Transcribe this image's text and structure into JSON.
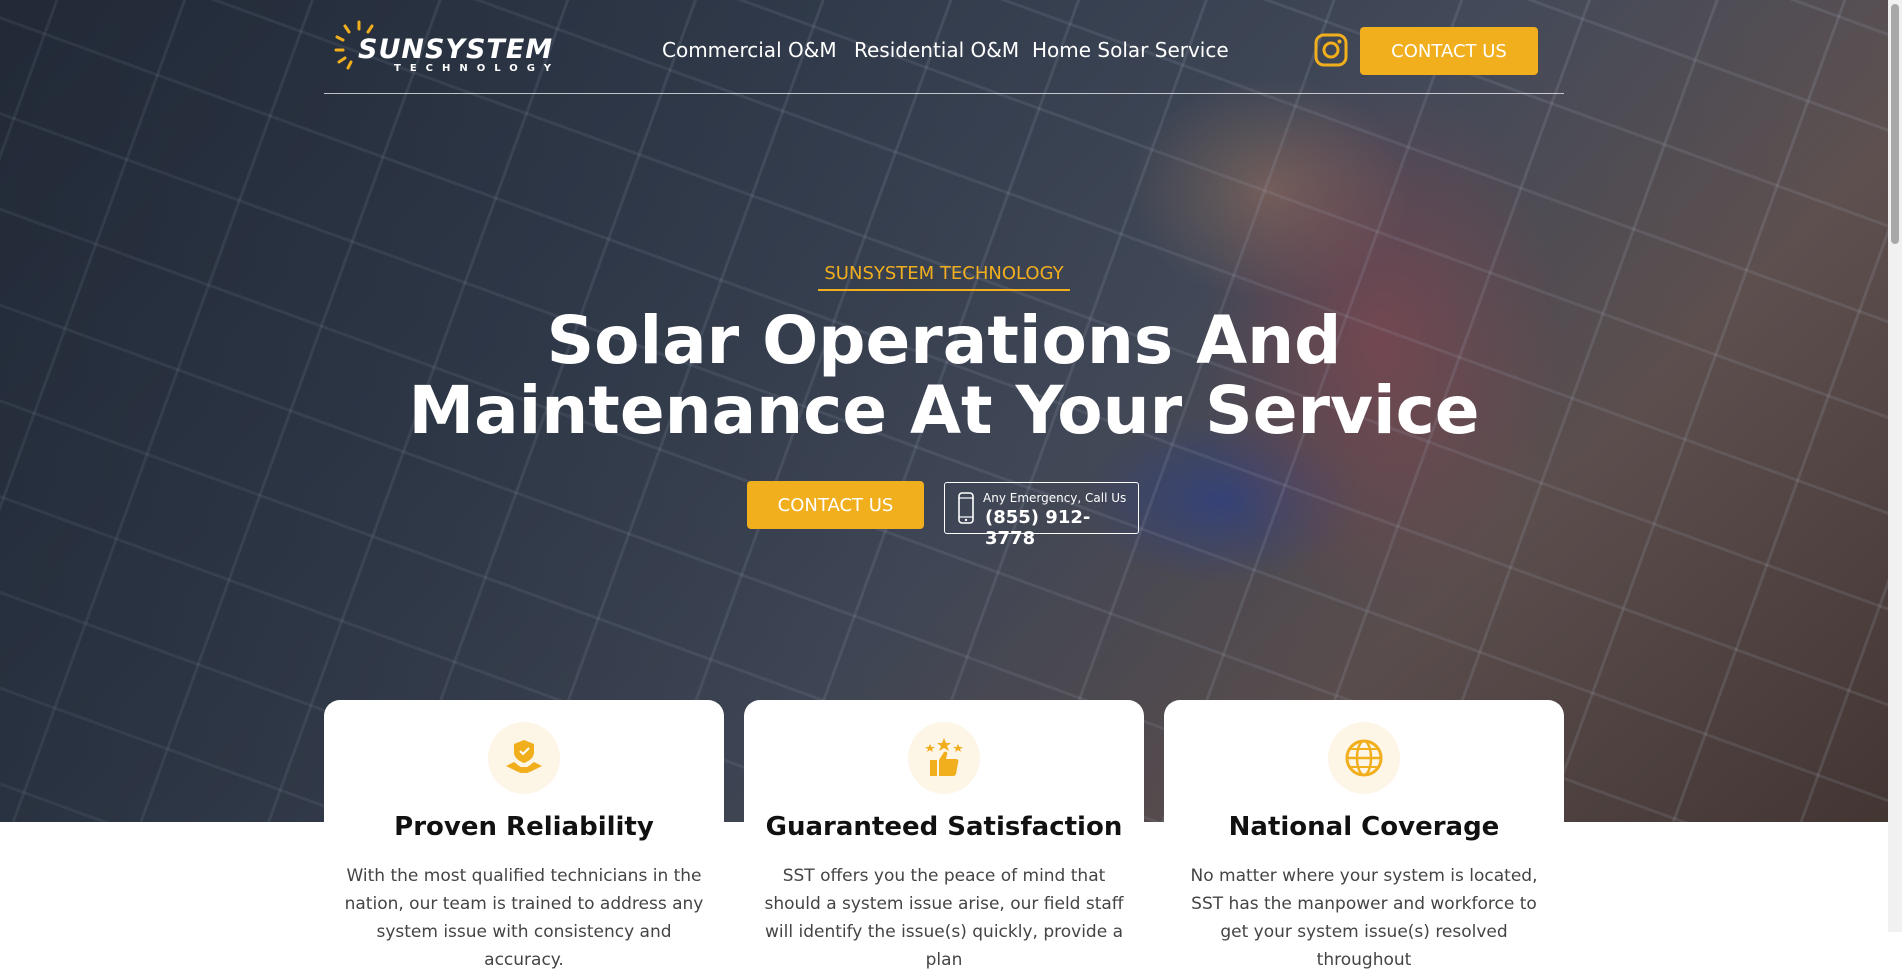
{
  "header": {
    "logo_word": "SUNSYSTEM",
    "logo_sub": "TECHNOLOGY",
    "nav": [
      "Commercial O&M",
      "Residential O&M",
      "Home Solar Service"
    ],
    "social_icon": "instagram-icon",
    "cta_label": "CONTACT US"
  },
  "hero": {
    "eyebrow": "SUNSYSTEM TECHNOLOGY",
    "title_line1": "Solar Operations And",
    "title_line2": "Maintenance At Your Service",
    "cta_label": "CONTACT US",
    "phone_caption": "Any Emergency, Call Us",
    "phone_number": "(855) 912-3778"
  },
  "cards": [
    {
      "icon": "handshake-shield-icon",
      "title": "Proven Reliability",
      "text": "With the most qualified technicians in the nation, our team is trained to address any system issue with consistency and accuracy."
    },
    {
      "icon": "thumbs-up-stars-icon",
      "title": "Guaranteed Satisfaction",
      "text": "SST offers you the peace of mind that should a system issue arise, our field staff will identify the issue(s) quickly, provide a plan"
    },
    {
      "icon": "globe-icon",
      "title": "National Coverage",
      "text": "No matter where your system is located, SST has the manpower and workforce to get your system issue(s) resolved throughout"
    }
  ],
  "colors": {
    "accent": "#f1ae1d",
    "text_dark": "#111111",
    "text_body": "#444444"
  }
}
